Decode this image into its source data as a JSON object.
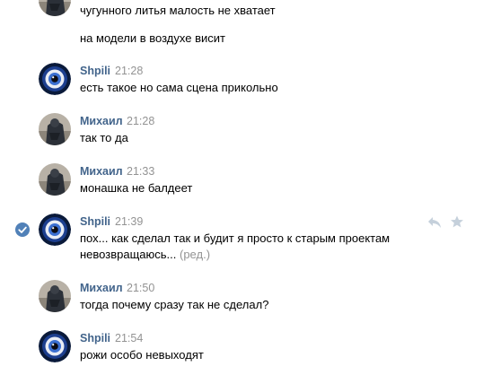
{
  "messages": [
    {
      "lines": [
        "чугунного литья малость не хватает"
      ]
    },
    {
      "lines": [
        "на модели в воздухе висит"
      ]
    },
    {
      "author": "Shpili",
      "time": "21:28",
      "lines": [
        "есть такое но сама сцена прикольно"
      ]
    },
    {
      "author": "Михаил",
      "time": "21:28",
      "lines": [
        "так то да"
      ]
    },
    {
      "author": "Михаил",
      "time": "21:33",
      "lines": [
        "монашка не балдеет"
      ]
    },
    {
      "author": "Shpili",
      "time": "21:39",
      "lines": [
        "пох... как сделал так и будит я просто к старым проектам",
        "невозвращаюсь..."
      ],
      "edited_label": "(ред.)"
    },
    {
      "author": "Михаил",
      "time": "21:50",
      "lines": [
        "тогда почему сразу так не сделал?"
      ]
    },
    {
      "author": "Shpili",
      "time": "21:54",
      "lines": [
        "рожи особо невыходят"
      ]
    }
  ],
  "icons": {
    "selected": "check-circle-icon",
    "reply": "reply-arrow-icon",
    "favorite": "star-icon"
  },
  "colors": {
    "author_link": "#42648b",
    "timestamp": "#939393",
    "selected_check": "#5181b8",
    "action_icon": "#c5d0db"
  }
}
